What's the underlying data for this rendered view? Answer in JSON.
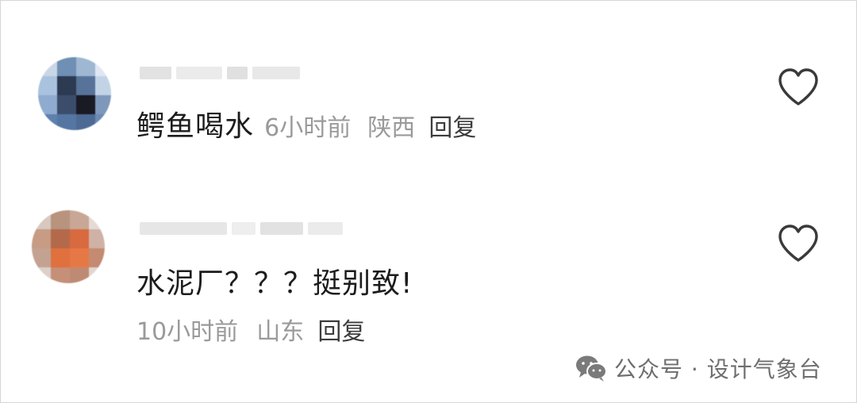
{
  "comments": [
    {
      "text": "鳄鱼喝水",
      "time": "6小时前",
      "location": "陕西",
      "reply_label": "回复"
    },
    {
      "text": "水泥厂？？？挺别致!",
      "time": "10小时前",
      "location": "山东",
      "reply_label": "回复"
    }
  ],
  "watermark": {
    "text": "公众号 · 设计气象台",
    "icon": "wechat-icon"
  },
  "icons": {
    "like": "heart-outline-icon"
  }
}
